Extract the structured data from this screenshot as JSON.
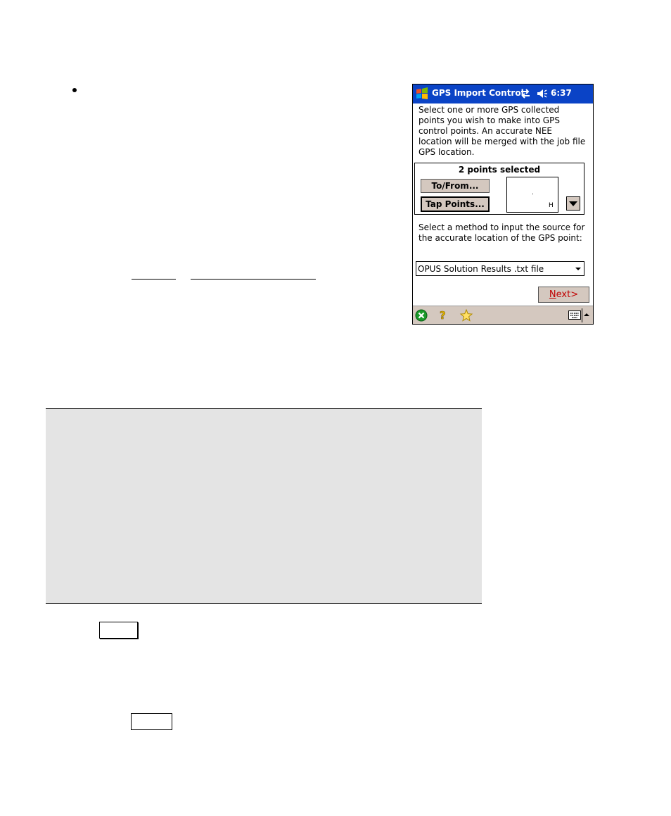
{
  "pda": {
    "title": "GPS Import Control",
    "clock": "6:37",
    "intro": "Select one or more GPS collected points you wish to make into GPS control points. An accurate NEE location will be merged with the job file GPS location.",
    "selection": {
      "count_label": "2 points selected",
      "to_from_label": "To/From...",
      "tap_points_label": "Tap Points...",
      "preview_axis_label": "H"
    },
    "method_label": "Select a method to input the source for the accurate location of the GPS point:",
    "method_selected": "OPUS Solution Results .txt file",
    "next_label_u": "N",
    "next_label_rest": "ext>"
  }
}
